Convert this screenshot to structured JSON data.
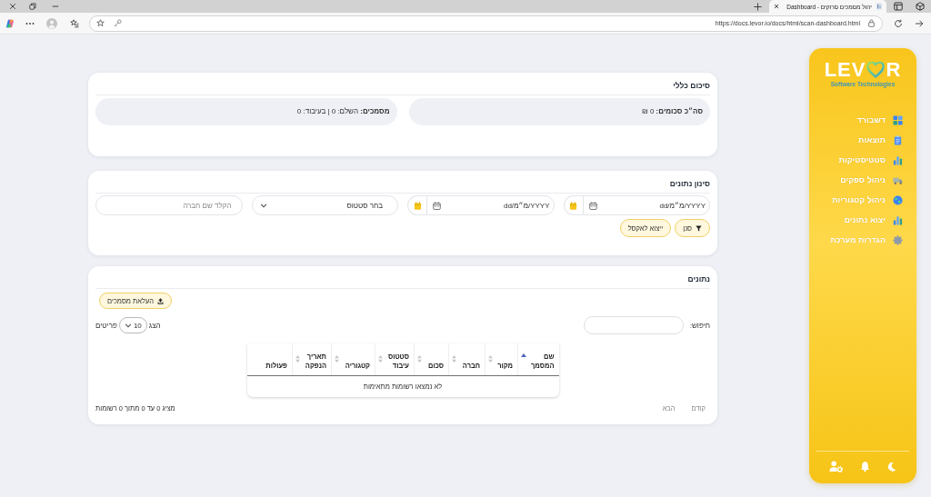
{
  "browser": {
    "tab": {
      "title": "יהול מסמכים סרוקים - Dashboard"
    },
    "address_bar": {
      "url": "https://docs.levor.io/docs/html/scan-dashboard.html"
    }
  },
  "sidebar": {
    "logo": {
      "before": "LEV",
      "after": "R",
      "tagline": "Software Technologies"
    },
    "items": [
      {
        "label": "דשבורד"
      },
      {
        "label": "תוצאות"
      },
      {
        "label": "סטטיסטיקות"
      },
      {
        "label": "ניהול ספקים"
      },
      {
        "label": "ניהול קטגוריות"
      },
      {
        "label": "יצוא נתונים"
      },
      {
        "label": "הגדרות מערכת"
      }
    ]
  },
  "summary": {
    "title": "סיכום כללי",
    "stats": [
      "**סה״כ סכומים:** 0 ₪",
      "**מסמכים:** השלם: 0 | בעיבוד: 0"
    ]
  },
  "filter": {
    "title": "סינון נתונים",
    "fields": [
      {
        "kind": "date",
        "placeholder": "dd/מ״מ/YYYY"
      },
      {
        "kind": "date",
        "placeholder": "dd/מ״מ/YYYY"
      },
      {
        "kind": "select",
        "value": "בחר סטטוס"
      },
      {
        "kind": "text",
        "placeholder": "הקלד שם חברה"
      }
    ],
    "buttons": [
      {
        "kind": "filter",
        "label": "סנן"
      },
      {
        "kind": "export",
        "label": "ייצוא לאקסל"
      }
    ]
  },
  "data": {
    "title": "נתונים",
    "upload_button": {
      "label": "העלאת מסמכים"
    },
    "search": {
      "label": "חיפוש:"
    },
    "page_size": {
      "before": "הצג",
      "value": "10",
      "after": "פריטים"
    },
    "table": {
      "columns": [
        {
          "label": "שם המסמך",
          "sortable": true,
          "sorted": true
        },
        {
          "label": "מקור",
          "sortable": true,
          "sorted": false
        },
        {
          "label": "חברה",
          "sortable": true,
          "sorted": false
        },
        {
          "label": "סכום",
          "sortable": true,
          "sorted": false
        },
        {
          "label": "סטטוס עיבוד",
          "sortable": true,
          "sorted": false
        },
        {
          "label": "קטגוריה",
          "sortable": true,
          "sorted": false
        },
        {
          "label": "תאריך הנפקה",
          "sortable": true,
          "sorted": false
        },
        {
          "label": "פעולות",
          "sortable": false,
          "sorted": false
        }
      ],
      "empty_message": "לא נמצאו רשומות מתאימות"
    },
    "info": "מציג 0 עד 0 מתוך 0 רשומות",
    "pagination": [
      {
        "label": "קודם",
        "disabled": true
      },
      {
        "label": "הבא",
        "disabled": true
      }
    ]
  }
}
